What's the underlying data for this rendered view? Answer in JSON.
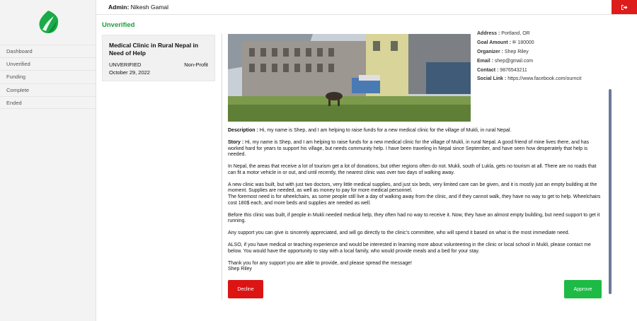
{
  "colors": {
    "accent_green": "#1a9e3a",
    "decline_red": "#dc1414",
    "approve_green": "#1dba45",
    "logout_red": "#dd1c1c"
  },
  "header": {
    "admin_label": "Admin:",
    "admin_name": "Nikesh Gamal",
    "logout_icon": "logout-icon"
  },
  "sidebar": {
    "logo_icon": "leaf-icon",
    "items": [
      {
        "label": "Dashboard"
      },
      {
        "label": "Unverified"
      },
      {
        "label": "Funding"
      },
      {
        "label": "Complete"
      },
      {
        "label": "Ended"
      }
    ]
  },
  "main": {
    "title": "Unverified",
    "card": {
      "title": "Medical Clinic in Rural Nepal in Need of Help",
      "status": "UNVERIFIED",
      "type": "Non-Profit",
      "date": "October 29, 2022"
    },
    "details": {
      "address_label": "Address :",
      "address_value": "Portland, OR",
      "goal_label": "Goal Amount :",
      "goal_value": "रू 180000",
      "organizer_label": "Organizer :",
      "organizer_value": "Shep Riley",
      "email_label": "Email :",
      "email_value": "shep@gmail.com",
      "contact_label": "Contact :",
      "contact_value": "9876543211",
      "social_label": "Social Link :",
      "social_value": "https://www.facebook.com/ourncit"
    },
    "description_label": "Description :",
    "description": "Hi, my name is Shep, and I am helping to raise funds for a new medical clinic for the village of Mukli, in rural Nepal.",
    "story_label": "Story :",
    "story_p1": "Hi, my name is Shep, and I am helping to raise funds for a new medical clinic for the village of Mukli, in rural Nepal. A good friend of mine lives there, and has worked hard for years to support his village, but needs community help. I have been traveling in Nepal since September, and have seen how desperately that help is needed.",
    "story_p2": "In Nepal, the areas that receive a lot of tourism get a lot of donations, but other regions often do not. Mukli, south of Lukla, gets no tourism at all. There are no roads that can fit a motor vehicle in or out, and until recently, the nearest clinic was over two days of walking away.",
    "story_p3a": "A new clinic was built, but with just two doctors, very little medical supplies, and just six beds, very limited care can be given, and it is mostly just an empty building at the moment. Supplies are needed, as well as money to pay for more medical personnel.",
    "story_p3b": "The foremost need is for wheelchairs, as some people still live a day of walking away from the clinic, and if they cannot walk, they have no way to get to help. Wheelchairs cost 180$ each, and more beds and supplies are needed as well.",
    "story_p4": "Before this clinic was built, if people in Mukli needed medical help, they often had no way to receive it. Now, they have an almost empty building, but need support to get it running.",
    "story_p5": "Any support you can give is sincerely appreciated, and will go directly to the clinic's committee, who will spend it based on what is the most immediate need.",
    "story_p6": "ALSO, if you have medical or teaching experience and would be interested in learning more about volunteering in the clinic or local school in Mukli, please contact me below. You would have the opportunity to stay with a local family, who would provide meals and a bed for your stay.",
    "story_p7": "Thank you for any support you are able to provide, and please spread the message!",
    "signature": "Shep Riley",
    "decline_label": "Decline",
    "approve_label": "Approve"
  }
}
